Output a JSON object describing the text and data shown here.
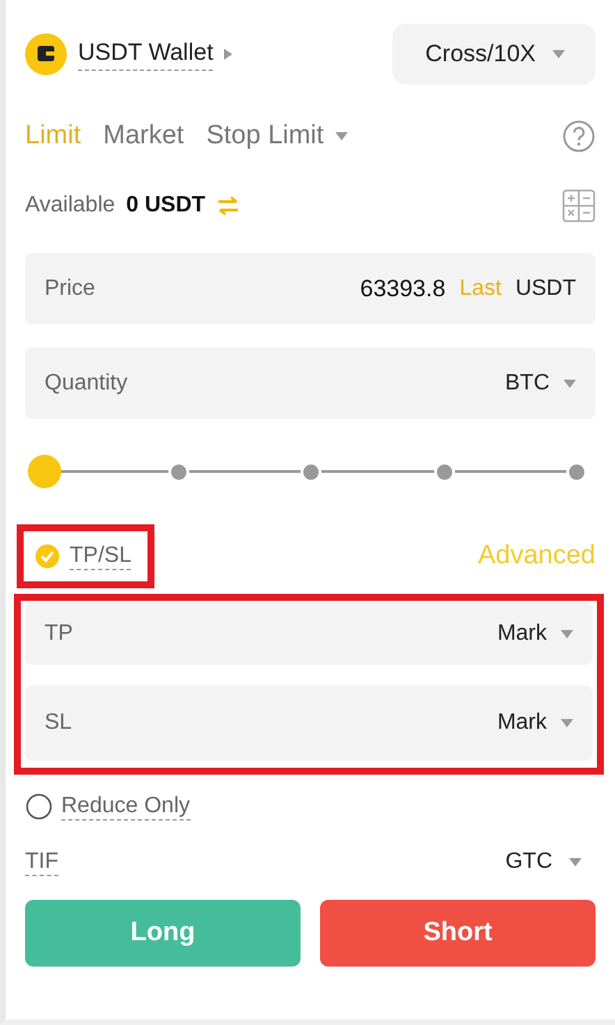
{
  "wallet": {
    "label": "USDT Wallet",
    "margin_mode": "Cross/10X"
  },
  "order_tabs": [
    {
      "label": "Limit",
      "selected": true,
      "dropdown": false
    },
    {
      "label": "Market",
      "selected": false,
      "dropdown": false
    },
    {
      "label": "Stop Limit",
      "selected": false,
      "dropdown": true
    }
  ],
  "available": {
    "label": "Available",
    "value": "0 USDT"
  },
  "price": {
    "label": "Price",
    "value": "63393.8",
    "tag": "Last",
    "unit": "USDT"
  },
  "quantity": {
    "label": "Quantity",
    "unit": "BTC"
  },
  "slider": {
    "level": 0
  },
  "tpsl": {
    "label": "TP/SL",
    "checked": true,
    "highlighted": true,
    "advanced": "Advanced"
  },
  "tpsl_fields": {
    "highlighted": true,
    "items": [
      {
        "label": "TP",
        "trigger": "Mark"
      },
      {
        "label": "SL",
        "trigger": "Mark"
      }
    ]
  },
  "reduce_only": {
    "label": "Reduce Only",
    "checked": false
  },
  "tif": {
    "label": "TIF",
    "value": "GTC"
  },
  "buttons": [
    {
      "label": "Long",
      "kind": "buy"
    },
    {
      "label": "Short",
      "kind": "sell"
    }
  ]
}
